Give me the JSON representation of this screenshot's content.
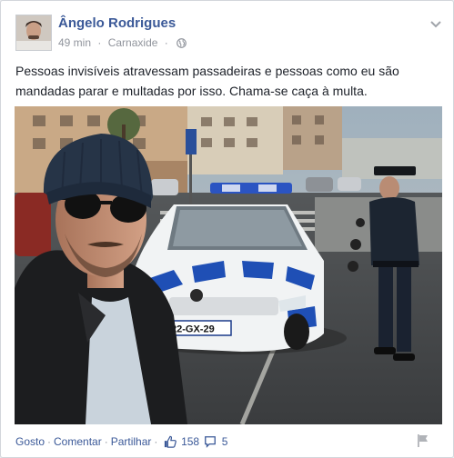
{
  "post": {
    "author": "Ângelo Rodrigues",
    "time": "49 min",
    "location": "Carnaxide",
    "text": "Pessoas invisíveis atravessam passadeiras e pessoas como eu são mandadas parar e multadas por isso. Chama-se caça à multa.",
    "plate_text": "22-GX-29"
  },
  "actions": {
    "like": "Gosto",
    "comment": "Comentar",
    "share": "Partilhar",
    "likes_count": "158",
    "comments_count": "5"
  },
  "icons": [
    "chevron-down-icon",
    "globe-icon",
    "like-thumb-icon",
    "comment-bubble-icon",
    "flag-icon"
  ],
  "colors": {
    "link": "#3b5998",
    "meta": "#90949c",
    "text": "#1d2129"
  }
}
